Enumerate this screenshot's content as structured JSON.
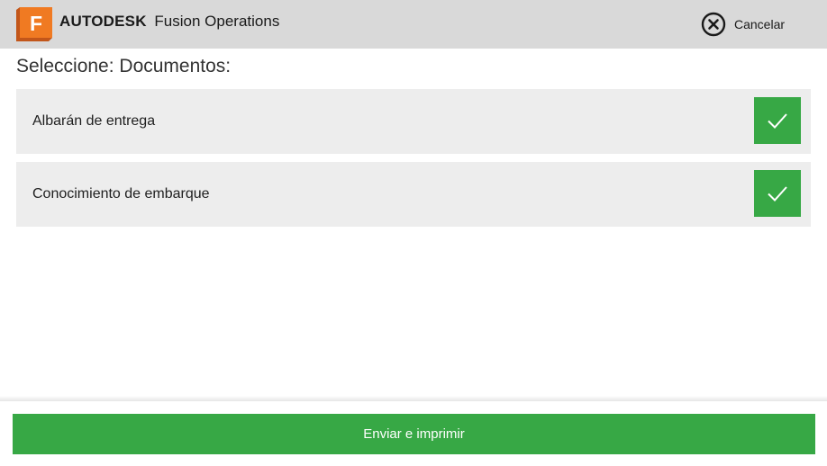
{
  "header": {
    "brand_company": "AUTODESK",
    "brand_product": "Fusion Operations",
    "logo_letter": "F",
    "logo_icon": "fusion-logo-icon",
    "cancel_icon": "close-circle-icon",
    "cancel_label": "Cancelar"
  },
  "main": {
    "title": "Seleccione: Documentos:",
    "documents": [
      {
        "label": "Albarán de entrega",
        "selected": true,
        "check_icon": "checkmark-icon"
      },
      {
        "label": "Conocimiento de embarque",
        "selected": true,
        "check_icon": "checkmark-icon"
      }
    ]
  },
  "footer": {
    "submit_label": "Enviar e imprimir"
  },
  "colors": {
    "header_bg": "#d9d9d9",
    "accent_green": "#37a845",
    "row_bg": "#ededed",
    "logo_orange": "#f07a22"
  }
}
